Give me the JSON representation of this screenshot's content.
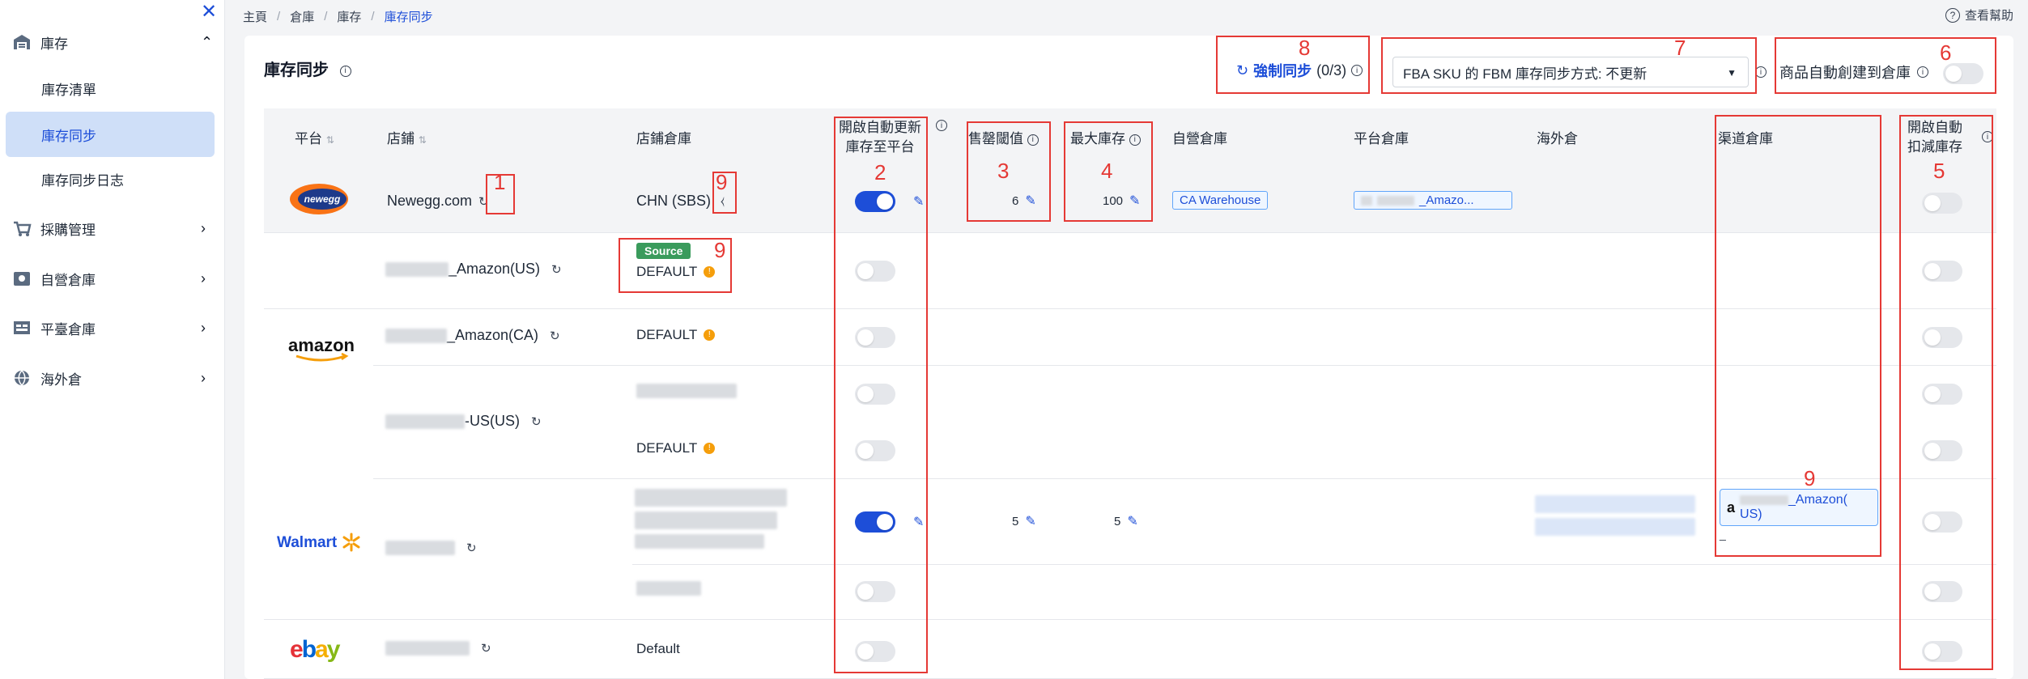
{
  "sidebar": {
    "close_icon": "close-icon",
    "items": [
      {
        "label": "庫存",
        "icon": "warehouse-icon",
        "expanded": true
      },
      {
        "label": "庫存清單"
      },
      {
        "label": "庫存同步",
        "active": true
      },
      {
        "label": "庫存同步日志"
      },
      {
        "label": "採購管理",
        "icon": "cart-icon"
      },
      {
        "label": "自營倉庫",
        "icon": "self-warehouse-icon"
      },
      {
        "label": "平臺倉庫",
        "icon": "platform-warehouse-icon"
      },
      {
        "label": "海外倉",
        "icon": "globe-icon"
      }
    ]
  },
  "breadcrumb": [
    "主頁",
    "倉庫",
    "庫存",
    "庫存同步"
  ],
  "help_label": "查看幫助",
  "page_title": "庫存同步",
  "toolbar": {
    "force_sync_label": "強制同步",
    "force_sync_count": "(0/3)",
    "fba_select_value": "FBA SKU 的 FBM 庫存同步方式: 不更新",
    "auto_create_label": "商品自動創建到倉庫"
  },
  "columns": {
    "platform": "平台",
    "store": "店鋪",
    "store_wh": "店鋪倉庫",
    "auto_update_1": "開啟自動更新",
    "auto_update_2": "庫存至平台",
    "threshold": "售罄閾值",
    "max_stock": "最大庫存",
    "self_wh": "自營倉庫",
    "platform_wh": "平台倉庫",
    "overseas": "海外倉",
    "channel_wh": "渠道倉庫",
    "auto_deduct_1": "開啟自動",
    "auto_deduct_2": "扣減庫存"
  },
  "rows": {
    "newegg": {
      "store": "Newegg.com",
      "wh": "CHN (SBS)",
      "threshold": "6",
      "max": "100",
      "self_wh": "CA Warehouse",
      "platform_wh": "_Amazo..."
    },
    "amazon_us": {
      "store": "_Amazon(US)",
      "source": "Source",
      "wh": "DEFAULT"
    },
    "amazon_ca": {
      "store": "_Amazon(CA)",
      "wh": "DEFAULT"
    },
    "amazon_3": {
      "store": "-US(US)",
      "wh": "DEFAULT"
    },
    "walmart": {
      "threshold": "5",
      "max": "5",
      "channel_line1": "_Amazon(",
      "channel_line2": "US)",
      "channel_dash": "_"
    },
    "ebay": {
      "wh": "Default"
    }
  },
  "logos": {
    "newegg": "newegg",
    "amazon": "amazon",
    "walmart": "Walmart",
    "ebay_e": "e",
    "ebay_b": "b",
    "ebay_a": "a",
    "ebay_y": "y"
  },
  "annotations": [
    "1",
    "2",
    "3",
    "4",
    "5",
    "6",
    "7",
    "8",
    "9",
    "9",
    "9"
  ]
}
